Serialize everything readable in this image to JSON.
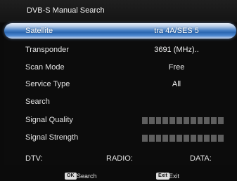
{
  "header": {
    "title": "DVB-S Manual Search"
  },
  "rows": [
    {
      "label": "Satellite",
      "value": "tra 4A/SES 5"
    },
    {
      "label": "Transponder",
      "value": "3691 (MHz).."
    },
    {
      "label": "Scan Mode",
      "value": "Free"
    },
    {
      "label": "Service Type",
      "value": "All"
    },
    {
      "label": "Search",
      "value": ""
    },
    {
      "label": "Signal Quality",
      "level": 0
    },
    {
      "label": "Signal Strength",
      "level": 0
    }
  ],
  "counts": {
    "dtv": "DTV:",
    "radio": "RADIO:",
    "data": "DATA:"
  },
  "footer": {
    "ok_key": "OK",
    "ok_label": "Search",
    "exit_key": "Exit",
    "exit_label": "Exit"
  },
  "colors": {
    "highlight": "#2a66b0",
    "signal_bar": "#5e5e5e"
  }
}
